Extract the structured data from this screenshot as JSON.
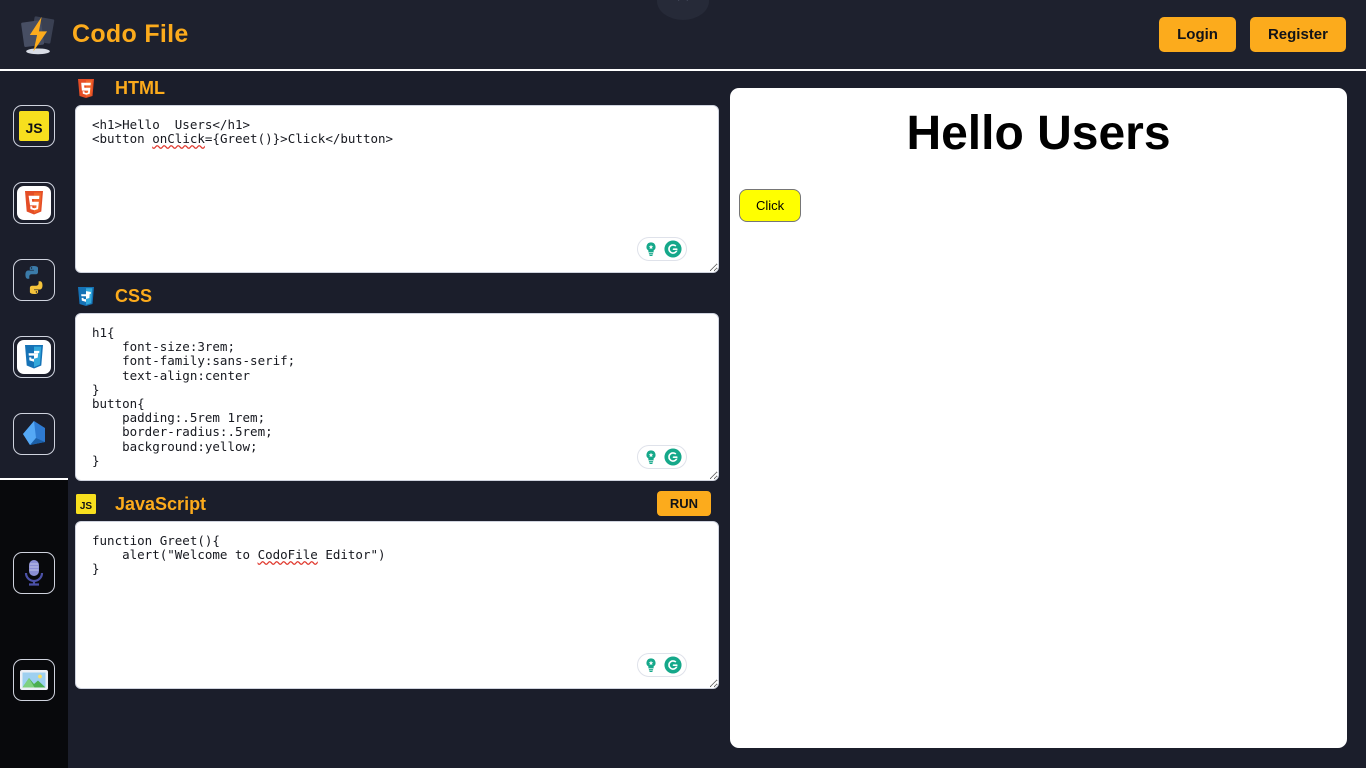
{
  "header": {
    "brand": "Codo File",
    "logo_icon": "lightning-file-icon",
    "close_icon": "close-icon",
    "login_label": "Login",
    "register_label": "Register",
    "accent_color": "#fcab1c",
    "bar_color": "#1e212e"
  },
  "sidebar": {
    "items": [
      {
        "icon": "javascript-icon",
        "label": "JS"
      },
      {
        "icon": "html5-icon",
        "label": "HTML5"
      },
      {
        "icon": "python-icon",
        "label": "Python"
      },
      {
        "icon": "css3-icon",
        "label": "CSS3"
      },
      {
        "icon": "dart-icon",
        "label": "Dart"
      }
    ],
    "lower_items": [
      {
        "icon": "microphone-icon",
        "label": "Microphone"
      },
      {
        "icon": "image-icon",
        "label": "Image"
      }
    ]
  },
  "editors": [
    {
      "id": "html",
      "title": "HTML",
      "icon": "html5-icon",
      "code": "<h1>Hello  Users</h1>\n<button onClick={Greet()}>Click</button>",
      "misspelled": "onClick",
      "assist_icons": [
        "lightbulb-icon",
        "grammarly-icon"
      ]
    },
    {
      "id": "css",
      "title": "CSS",
      "icon": "css3-icon",
      "code": "h1{\n    font-size:3rem;\n    font-family:sans-serif;\n    text-align:center\n}\nbutton{\n    padding:.5rem 1rem;\n    border-radius:.5rem;\n    background:yellow;\n}",
      "misspelled": "",
      "assist_icons": [
        "lightbulb-icon",
        "grammarly-icon"
      ]
    },
    {
      "id": "javascript",
      "title": "JavaScript",
      "icon": "javascript-icon",
      "run_label": "RUN",
      "code": "function Greet(){\n    alert(\"Welcome to CodoFile Editor\")\n}",
      "misspelled": "CodoFile",
      "assist_icons": [
        "lightbulb-icon",
        "grammarly-icon"
      ]
    }
  ],
  "preview": {
    "heading": "Hello Users",
    "button_label": "Click",
    "button_color": "#ffff00",
    "background": "#ffffff"
  }
}
